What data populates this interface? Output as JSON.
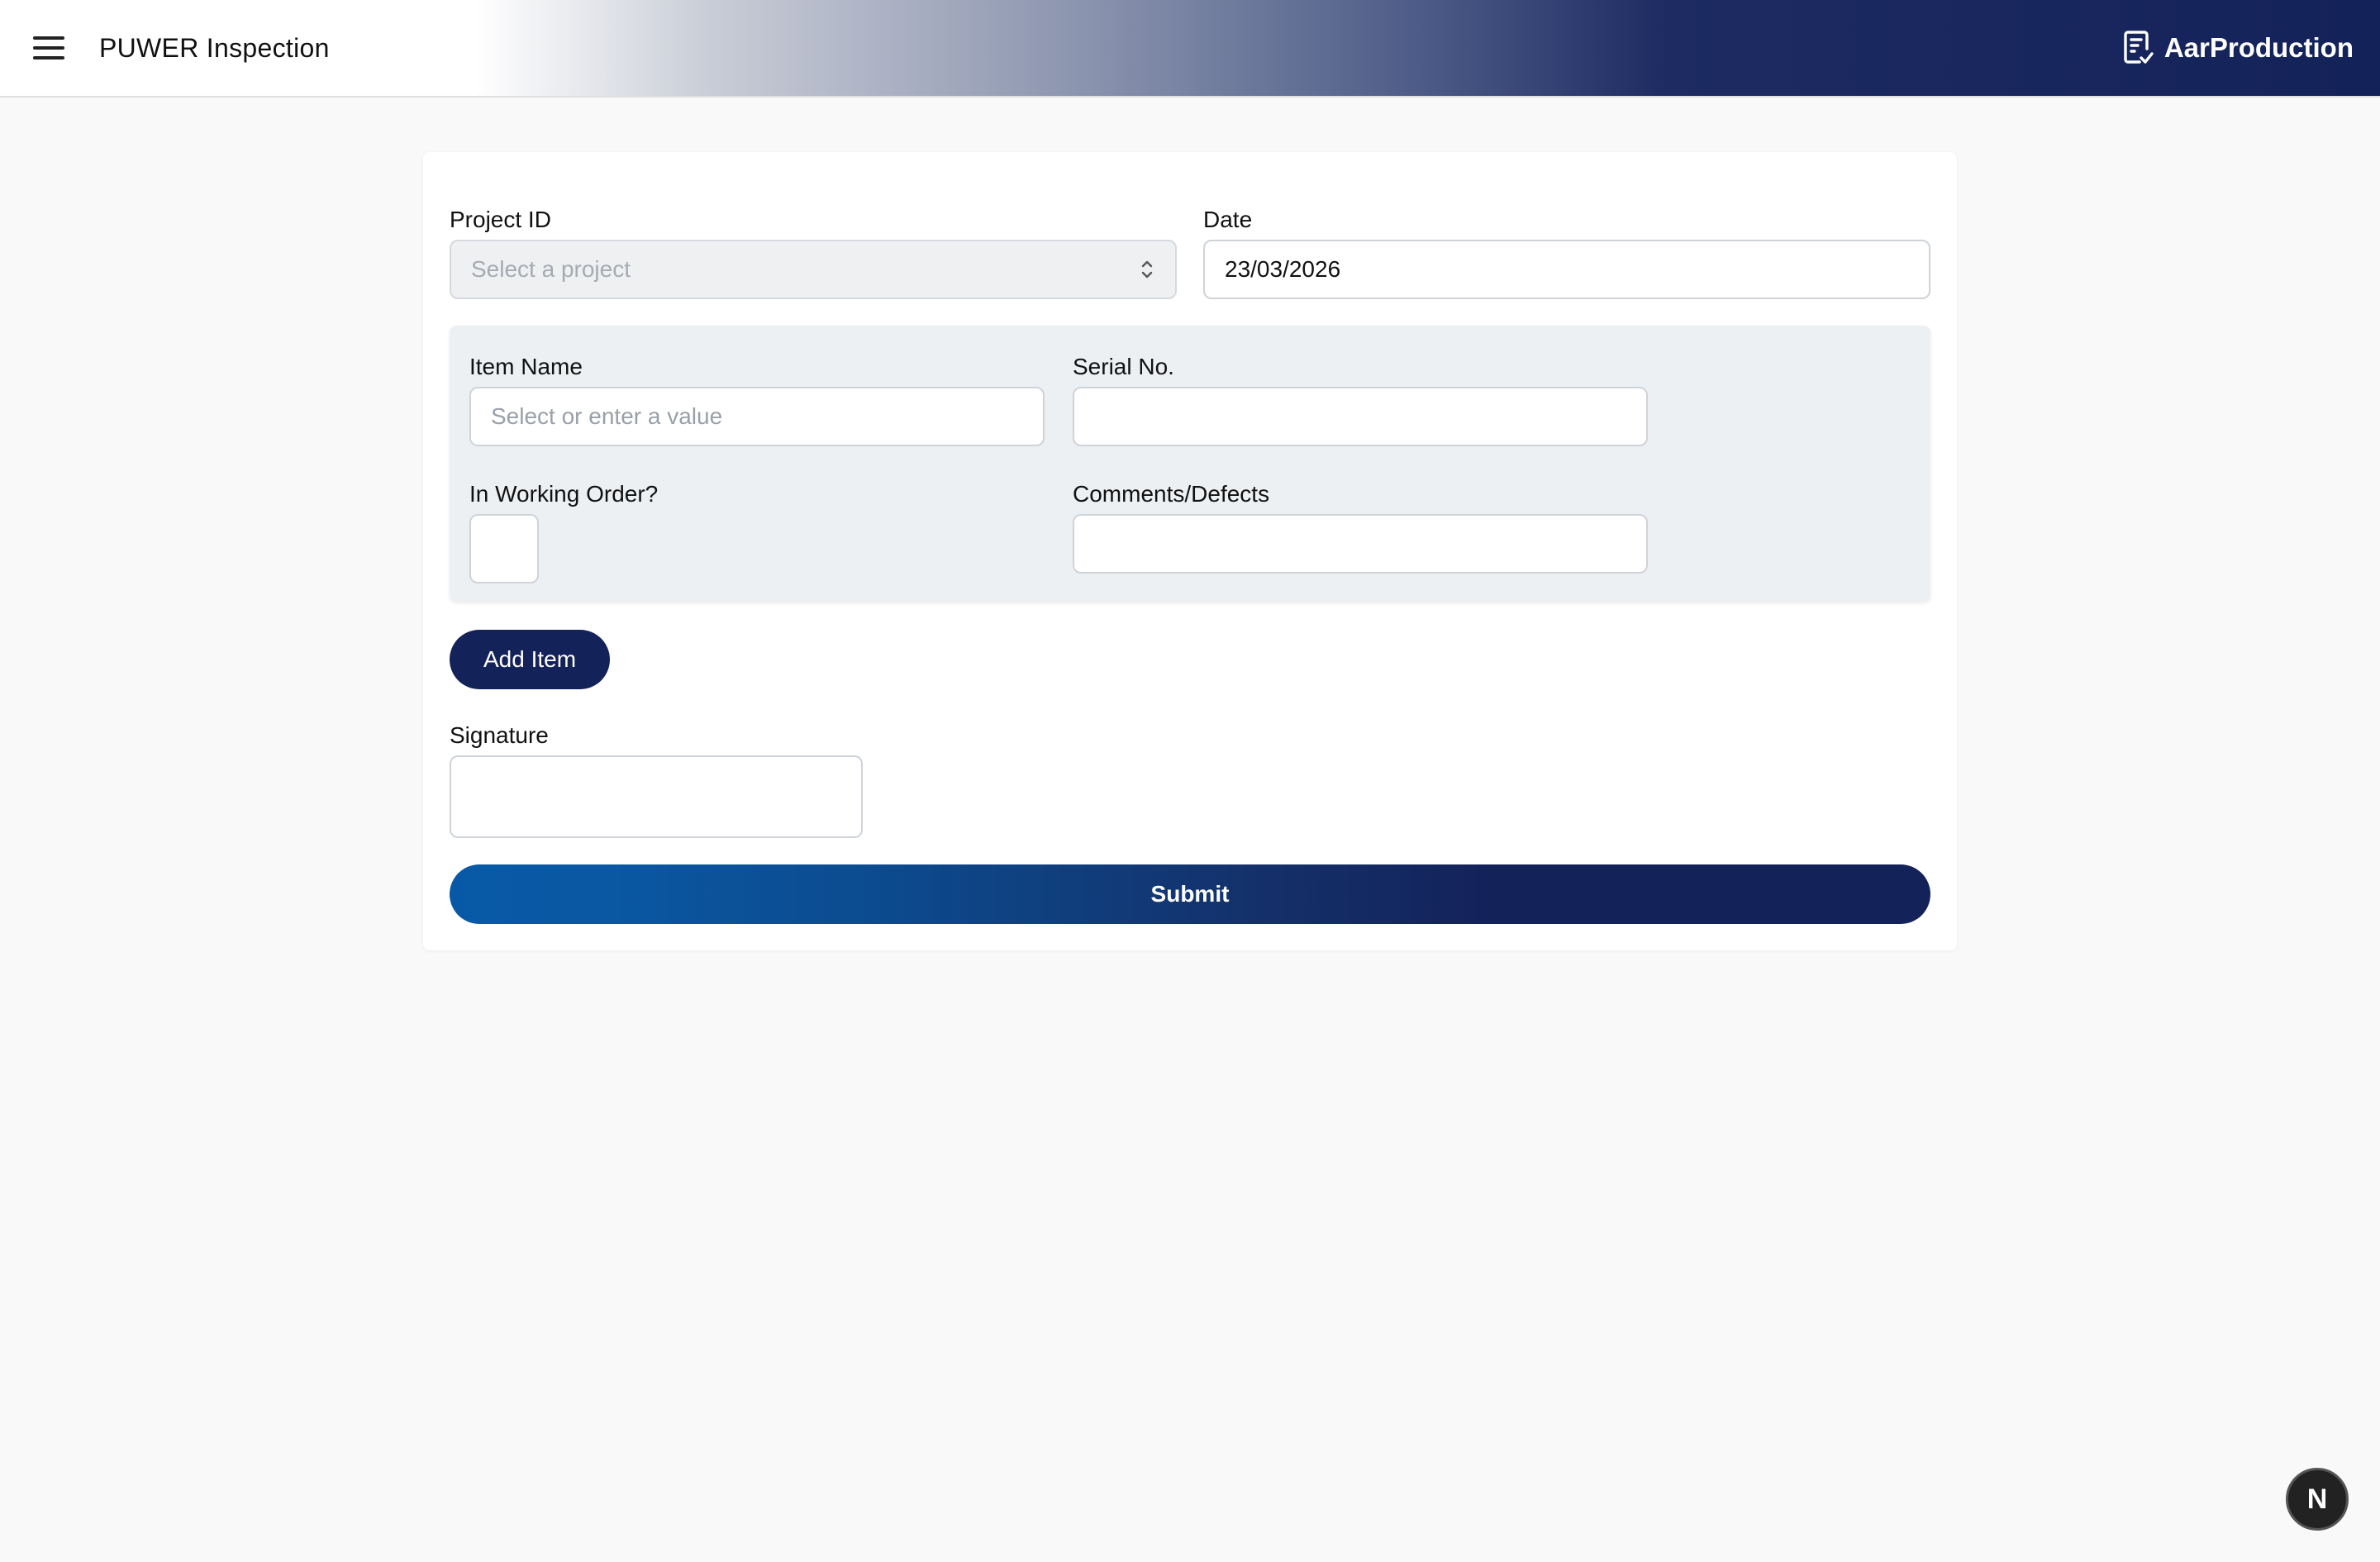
{
  "header": {
    "title": "PUWER Inspection",
    "brand": "AarProduction",
    "menu_icon": "hamburger-menu-icon",
    "brand_icon": "clipboard-check-icon"
  },
  "form": {
    "project_id": {
      "label": "Project ID",
      "placeholder": "Select a project",
      "value": ""
    },
    "date": {
      "label": "Date",
      "value": "23/03/2026"
    },
    "item": {
      "item_name": {
        "label": "Item Name",
        "placeholder": "Select or enter a value",
        "value": ""
      },
      "serial_no": {
        "label": "Serial No.",
        "value": ""
      },
      "in_working_order": {
        "label": "In Working Order?",
        "checked": false
      },
      "comments": {
        "label": "Comments/Defects",
        "value": ""
      }
    },
    "add_item_label": "Add Item",
    "signature": {
      "label": "Signature"
    },
    "submit_label": "Submit"
  },
  "fab": {
    "label": "N",
    "icon": "nextjs-logo-icon"
  },
  "colors": {
    "primary": "#14225a",
    "accent_blue": "#0759a7",
    "background": "#f9f9f9",
    "panel": "#edf0f3"
  }
}
